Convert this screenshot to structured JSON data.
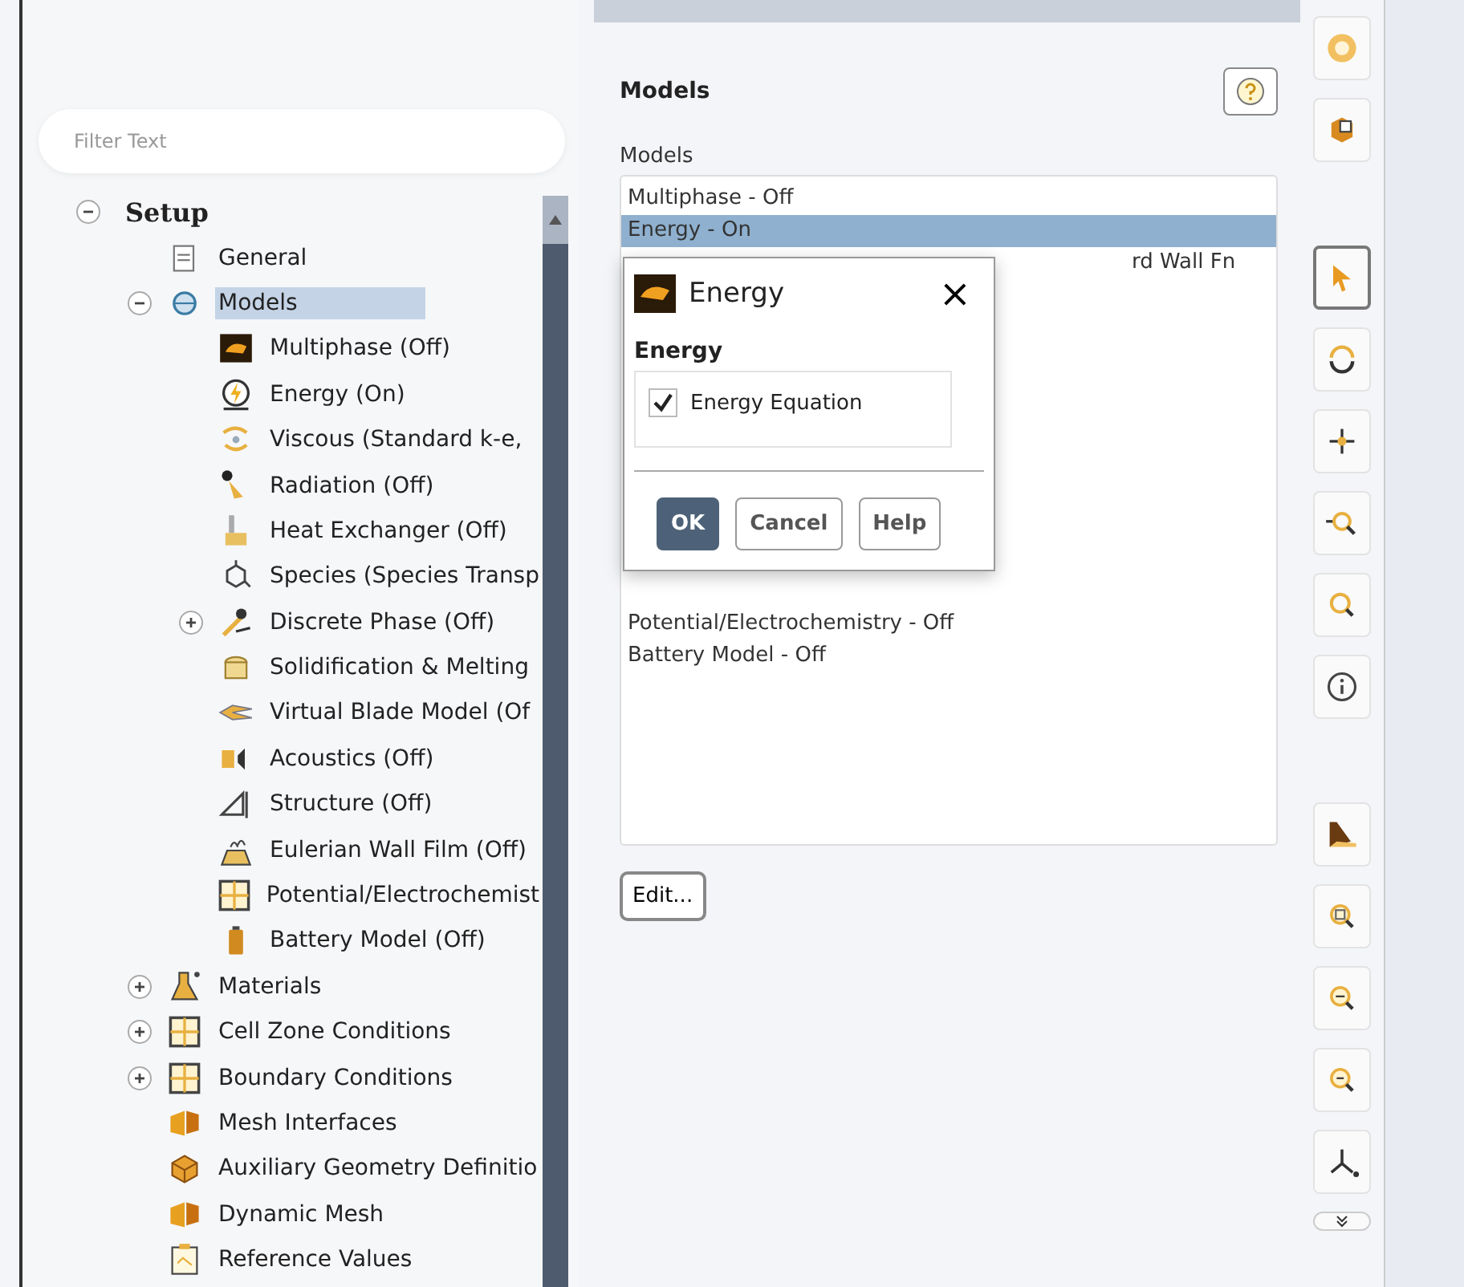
{
  "tree_panel": {
    "filter": {
      "placeholder": "Filter Text"
    },
    "tree": [
      {
        "label": "Setup",
        "expanded": true,
        "selected": false,
        "children": [
          {
            "label": "General",
            "selected": false
          },
          {
            "label": "Models",
            "expanded": true,
            "selected": true,
            "children": [
              {
                "label": "Multiphase (Off)",
                "selected": false
              },
              {
                "label": "Energy (On)",
                "selected": false
              },
              {
                "label": "Viscous (Standard k-e,",
                "selected": false
              },
              {
                "label": "Radiation (Off)",
                "selected": false
              },
              {
                "label": "Heat Exchanger (Off)",
                "selected": false
              },
              {
                "label": "Species (Species Transp",
                "selected": false
              },
              {
                "label": "Discrete Phase (Off)",
                "expanded": false,
                "selected": false
              },
              {
                "label": "Solidification & Melting",
                "selected": false
              },
              {
                "label": "Virtual Blade Model (Of",
                "selected": false
              },
              {
                "label": "Acoustics (Off)",
                "selected": false
              },
              {
                "label": "Structure (Off)",
                "selected": false
              },
              {
                "label": "Eulerian Wall Film (Off)",
                "selected": false
              },
              {
                "label": "Potential/Electrochemist",
                "selected": false
              },
              {
                "label": "Battery Model (Off)",
                "selected": false
              }
            ]
          },
          {
            "label": "Materials",
            "expanded": false,
            "selected": false
          },
          {
            "label": "Cell Zone Conditions",
            "expanded": false,
            "selected": false
          },
          {
            "label": "Boundary Conditions",
            "expanded": false,
            "selected": false
          },
          {
            "label": "Mesh Interfaces",
            "selected": false
          },
          {
            "label": "Auxiliary Geometry Definitio",
            "selected": false
          },
          {
            "label": "Dynamic Mesh",
            "selected": false
          },
          {
            "label": "Reference Values",
            "selected": false
          }
        ]
      }
    ]
  },
  "task_page": {
    "title": "Models",
    "list_label": "Models",
    "models": [
      {
        "label": "Multiphase - Off",
        "selected": false
      },
      {
        "label": "Energy - On",
        "selected": true
      },
      {
        "label": "rd Wall Fn",
        "selected": false,
        "kind": "covered"
      },
      {
        "label": "Potential/Electrochemistry - Off",
        "selected": false,
        "kind": "lower"
      },
      {
        "label": "Battery Model - Off",
        "selected": false,
        "kind": "lower"
      }
    ],
    "edit_button": "Edit..."
  },
  "dialog": {
    "title": "Energy",
    "close": "×",
    "group": "Energy",
    "checkbox": {
      "label": "Energy Equation",
      "checked": true
    },
    "buttons": [
      {
        "label": "OK",
        "primary": true
      },
      {
        "label": "Cancel",
        "primary": false
      },
      {
        "label": "Help",
        "primary": false
      }
    ]
  },
  "toolbar": [
    [
      {
        "selected": false
      },
      {
        "selected": false
      }
    ],
    [
      {
        "selected": true
      },
      {
        "selected": false
      },
      {
        "selected": false
      },
      {
        "selected": false
      },
      {
        "selected": false
      },
      {
        "selected": false
      }
    ],
    [
      {
        "selected": false
      },
      {
        "selected": false
      },
      {
        "selected": false
      },
      {
        "selected": false
      },
      {
        "selected": false
      }
    ]
  ]
}
